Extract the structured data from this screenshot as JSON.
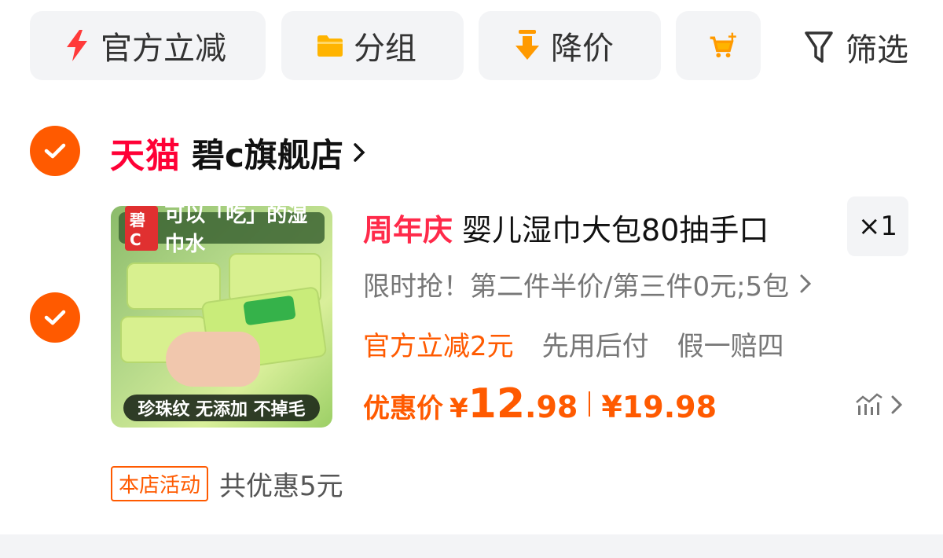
{
  "filters": {
    "chips": [
      {
        "label": "官方立减",
        "icon": "lightning-icon"
      },
      {
        "label": "分组",
        "icon": "folder-icon"
      },
      {
        "label": "降价",
        "icon": "down-arrow-icon"
      },
      {
        "label": "",
        "icon": "cart-add-icon"
      }
    ],
    "filter_label": "筛选",
    "filter_icon": "funnel-icon"
  },
  "store": {
    "platform": "天猫",
    "name": "碧c旗舰店"
  },
  "item": {
    "image_text": {
      "brand_tag": "碧C",
      "headline": "可以「吃」的湿巾水",
      "footer": "珍珠纹 无添加 不掉毛"
    },
    "title_tag": "周年庆",
    "title": "婴儿湿巾大包80抽手口",
    "quantity": "×1",
    "sku": "限时抢！第二件半价/第三件0元;5包",
    "promos": [
      "官方立减2元",
      "先用后付",
      "假一赔四"
    ],
    "price": {
      "label": "优惠价",
      "yen": "¥",
      "integer": "12",
      "decimal": ".98",
      "original": "¥19.98"
    }
  },
  "activity": {
    "badge": "本店活动",
    "text": "共优惠5元"
  },
  "colors": {
    "accent": "#ff5a00",
    "tmall_red": "#ff0036",
    "chip_bg": "#f3f4f6"
  }
}
